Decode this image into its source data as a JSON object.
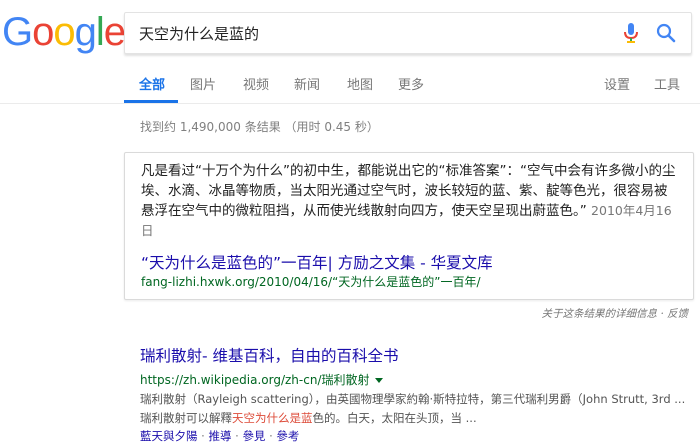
{
  "logo": {
    "letters": [
      "G",
      "o",
      "o",
      "g",
      "l",
      "e"
    ],
    "colors": [
      "#4285f4",
      "#ea4335",
      "#fbbc05",
      "#4285f4",
      "#34a853",
      "#ea4335"
    ]
  },
  "search": {
    "query": "天空为什么是蓝的"
  },
  "tabs": {
    "all": "全部",
    "images": "图片",
    "videos": "视频",
    "news": "新闻",
    "maps": "地图",
    "more": "更多",
    "settings": "设置",
    "tools": "工具"
  },
  "stats": "找到约 1,490,000 条结果 （用时 0.45 秒）",
  "snippet": {
    "text": "凡是看过“十万个为什么”的初中生，都能说出它的“标准答案”：“空气中会有许多微小的尘埃、水滴、冰晶等物质，当太阳光通过空气时，波长较短的蓝、紫、靛等色光，很容易被悬浮在空气中的微粒阻挡，从而使光线散射向四方，使天空呈现出蔚蓝色。”",
    "date": "2010年4月16日",
    "title": "“天为什么是蓝色的”一百年| 方励之文集 - 华夏文库",
    "url": "fang-lizhi.hxwk.org/2010/04/16/“天为什么是蓝色的”一百年/"
  },
  "feedback": "关于这条结果的详细信息 · 反馈",
  "result2": {
    "title": "瑞利散射- 维基百科，自由的百科全书",
    "url": "https://zh.wikipedia.org/zh-cn/瑞利散射",
    "desc_line1": "瑞利散射（Rayleigh scattering），由英國物理學家約翰·斯特拉特，第三代瑞利男爵（John Strutt, 3rd ...",
    "desc_line2_pre": "瑞利散射可以解釋",
    "desc_line2_hl": "天空为什么是蓝",
    "desc_line2_post": "色的。白天，太阳在头顶，当 ...",
    "links": [
      "藍天與夕陽",
      "推導",
      "參見",
      "參考"
    ],
    "link_sep": " · "
  }
}
